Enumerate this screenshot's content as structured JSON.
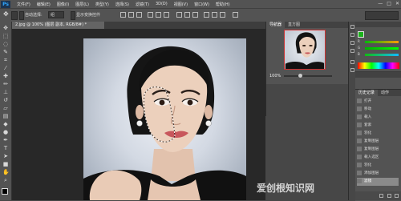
{
  "app": {
    "logo": "Ps"
  },
  "menu": [
    "文件(F)",
    "编辑(E)",
    "图像(I)",
    "图层(L)",
    "类型(Y)",
    "选择(S)",
    "滤镜(T)",
    "3D(D)",
    "视图(V)",
    "窗口(W)",
    "帮助(H)"
  ],
  "window_controls": [
    "—",
    "□",
    "✕"
  ],
  "options_bar": {
    "auto_select_label": "自动选择:",
    "auto_select_value": "组",
    "show_transform_label": "显示变换控件"
  },
  "document": {
    "tab_title": "2.jpg @ 100% (图层 副本, RGB/8#) *"
  },
  "navigator": {
    "tabs": [
      "导航器",
      "直方图"
    ],
    "zoom": "100%"
  },
  "history": {
    "tabs": [
      "历史记录",
      "动作"
    ],
    "items": [
      "打开",
      "移动",
      "载入",
      "套索",
      "羽化",
      "复制图层",
      "复制图层",
      "载入选区",
      "羽化",
      "添加图层",
      "滤镜"
    ],
    "selected_index": 10
  },
  "icons": [
    "ps-logo",
    "move-tool-icon",
    "marquee-tool-icon",
    "lasso-tool-icon",
    "quick-select-icon",
    "crop-tool-icon",
    "eyedropper-icon",
    "healing-brush-icon",
    "brush-tool-icon",
    "clone-stamp-icon",
    "history-brush-icon",
    "eraser-icon",
    "gradient-icon",
    "blur-icon",
    "dodge-icon",
    "pen-tool-icon",
    "type-tool-icon",
    "path-select-icon",
    "shape-tool-icon",
    "hand-tool-icon",
    "zoom-tool-icon"
  ],
  "colors": {
    "foreground": "#1bb31b",
    "ui_dark": "#474747",
    "ui_panel": "#535353"
  },
  "watermark": "爱创根知识网"
}
